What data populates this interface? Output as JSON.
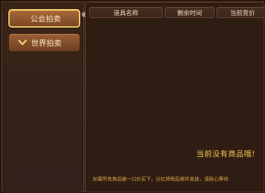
{
  "sidebar": {
    "items": [
      {
        "label": "公会拍卖",
        "active": true
      },
      {
        "label": "世界拍卖",
        "active": false,
        "icon": "chevron-down-icon"
      }
    ]
  },
  "table": {
    "columns": [
      "道具名称",
      "剩余时间",
      "当前竞价"
    ]
  },
  "empty_message": "当前没有商品哦!",
  "footer_note": "如果所有商品被一口价买下，分红将稍后邮件发放，请耐心等待",
  "colors": {
    "accent_gold": "#f2c94a",
    "button_brown": "#8a5430",
    "panel_bg": "#2f1d14"
  }
}
